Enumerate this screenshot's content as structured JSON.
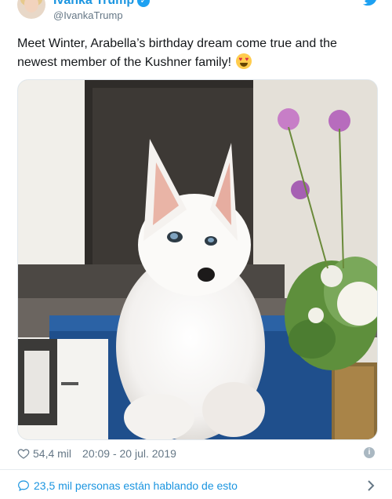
{
  "author": {
    "name": "Ivanka Trump",
    "handle": "@IvankaTrump"
  },
  "tweet": {
    "text": "Meet Winter, Arabella’s birthday dream come true and the newest member of the Kushner family!",
    "emoji": "heart-eyes-emoji"
  },
  "footer": {
    "likes": "54,4 mil",
    "timestamp": "20:09 - 20 jul. 2019"
  },
  "conversation": {
    "label": "23,5 mil personas están hablando de esto"
  },
  "colors": {
    "link_blue": "#1b95e0",
    "twitter_blue": "#1da1f2",
    "muted_gray": "#657786"
  },
  "icons": [
    "verified-badge-icon",
    "twitter-bird-icon",
    "heart-icon",
    "info-icon",
    "speech-bubble-icon",
    "chevron-right-icon"
  ]
}
